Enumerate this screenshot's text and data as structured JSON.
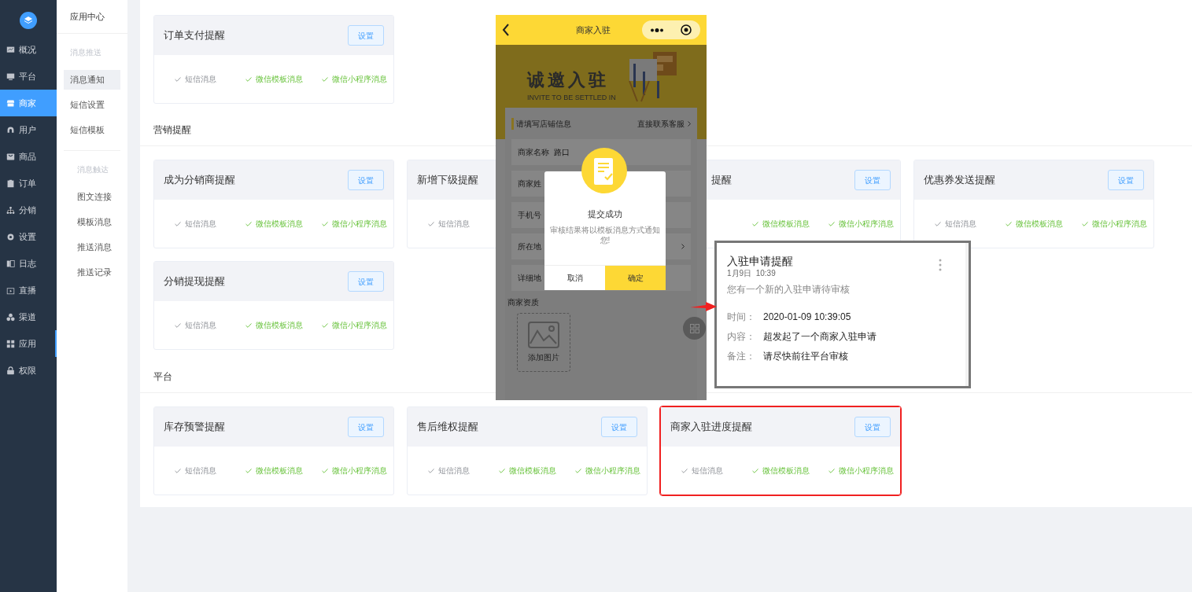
{
  "sidebar": {
    "items": [
      {
        "label": "概况",
        "selected": false,
        "marked": false
      },
      {
        "label": "平台",
        "selected": false,
        "marked": false
      },
      {
        "label": "商家",
        "selected": true,
        "marked": false
      },
      {
        "label": "用户",
        "selected": false,
        "marked": false
      },
      {
        "label": "商品",
        "selected": false,
        "marked": false
      },
      {
        "label": "订单",
        "selected": false,
        "marked": false
      },
      {
        "label": "分销",
        "selected": false,
        "marked": false
      },
      {
        "label": "设置",
        "selected": false,
        "marked": false
      },
      {
        "label": "日志",
        "selected": false,
        "marked": false
      },
      {
        "label": "直播",
        "selected": false,
        "marked": false
      },
      {
        "label": "渠道",
        "selected": false,
        "marked": false
      },
      {
        "label": "应用",
        "selected": false,
        "marked": true
      },
      {
        "label": "权限",
        "selected": false,
        "marked": false
      }
    ]
  },
  "submenu": {
    "title": "应用中心",
    "groups": [
      {
        "label": "消息推送",
        "items": [
          {
            "label": "消息通知",
            "selected": true
          },
          {
            "label": "短信设置",
            "selected": false
          },
          {
            "label": "短信模板",
            "selected": false
          }
        ]
      },
      {
        "label": "消息触达",
        "items": [
          {
            "label": "图文连接",
            "selected": false
          },
          {
            "label": "模板消息",
            "selected": false
          },
          {
            "label": "推送消息",
            "selected": false
          },
          {
            "label": "推送记录",
            "selected": false
          }
        ]
      }
    ]
  },
  "sections": [
    {
      "cards": [
        {
          "title": "订单支付提醒",
          "button": "设置",
          "channels": [
            {
              "label": "短信消息",
              "enabled": false
            },
            {
              "label": "微信模板消息",
              "enabled": true
            },
            {
              "label": "微信小程序消息",
              "enabled": true
            }
          ]
        }
      ]
    },
    {
      "heading": "营销提醒",
      "cards": [
        {
          "title": "成为分销商提醒",
          "button": "设置",
          "channels": [
            {
              "label": "短信消息",
              "enabled": false
            },
            {
              "label": "微信模板消息",
              "enabled": true
            },
            {
              "label": "微信小程序消息",
              "enabled": true
            }
          ]
        },
        {
          "title": "新增下级提醒",
          "channels": [
            {
              "label": "短信消息",
              "enabled": false
            }
          ]
        },
        {
          "title": "提醒",
          "partly_hidden": true,
          "button": "设置",
          "channels": [
            {
              "label": "微信模板消息",
              "enabled": true
            },
            {
              "label": "微信小程序消息",
              "enabled": true
            }
          ]
        },
        {
          "title": "优惠券发送提醒",
          "button": "设置",
          "channels": [
            {
              "label": "短信消息",
              "enabled": false
            },
            {
              "label": "微信模板消息",
              "enabled": true
            },
            {
              "label": "微信小程序消息",
              "enabled": true
            }
          ]
        },
        {
          "title": "分销提现提醒",
          "button": "设置",
          "channels": [
            {
              "label": "短信消息",
              "enabled": false
            },
            {
              "label": "微信模板消息",
              "enabled": true
            },
            {
              "label": "微信小程序消息",
              "enabled": true
            }
          ]
        }
      ]
    },
    {
      "heading": "平台",
      "cards": [
        {
          "title": "库存预警提醒",
          "button": "设置",
          "channels": [
            {
              "label": "短信消息",
              "enabled": false
            },
            {
              "label": "微信模板消息",
              "enabled": true
            },
            {
              "label": "微信小程序消息",
              "enabled": true
            }
          ]
        },
        {
          "title": "售后维权提醒",
          "button": "设置",
          "channels": [
            {
              "label": "短信消息",
              "enabled": false
            },
            {
              "label": "微信模板消息",
              "enabled": true
            },
            {
              "label": "微信小程序消息",
              "enabled": true
            }
          ]
        },
        {
          "title": "商家入驻进度提醒",
          "button": "设置",
          "highlighted": true,
          "channels": [
            {
              "label": "短信消息",
              "enabled": false
            },
            {
              "label": "微信模板消息",
              "enabled": true
            },
            {
              "label": "微信小程序消息",
              "enabled": true
            }
          ]
        }
      ]
    }
  ],
  "phone": {
    "title": "商家入驻",
    "banner": {
      "title": "诚邀入驻",
      "subtitle": "INVITE TO BE SETTLED IN"
    },
    "form": {
      "heading": "请填写店铺信息",
      "link": "直接联系客服",
      "fields": [
        {
          "label": "商家名称",
          "value": "路口",
          "kind": "text"
        },
        {
          "label": "商家姓",
          "kind": "text"
        },
        {
          "label": "手机号",
          "kind": "text"
        },
        {
          "label": "所在地",
          "kind": "select"
        },
        {
          "label": "详细地",
          "kind": "text"
        }
      ]
    },
    "upload": {
      "label": "商家资质",
      "button": "添加图片"
    },
    "dialog": {
      "title": "提交成功",
      "message": "审核结果将以模板消息方式通知您!",
      "cancel": "取消",
      "confirm": "确定"
    }
  },
  "notification": {
    "title": "入驻申请提醒",
    "time": "1月9日  10:39",
    "summary": "您有一个新的入驻申请待审核",
    "rows": [
      {
        "label": "时间：",
        "value": "2020-01-09 10:39:05"
      },
      {
        "label": "内容：",
        "value": "超发起了一个商家入驻申请"
      },
      {
        "label": "备注：",
        "value": "请尽快前往平台审核"
      }
    ]
  }
}
